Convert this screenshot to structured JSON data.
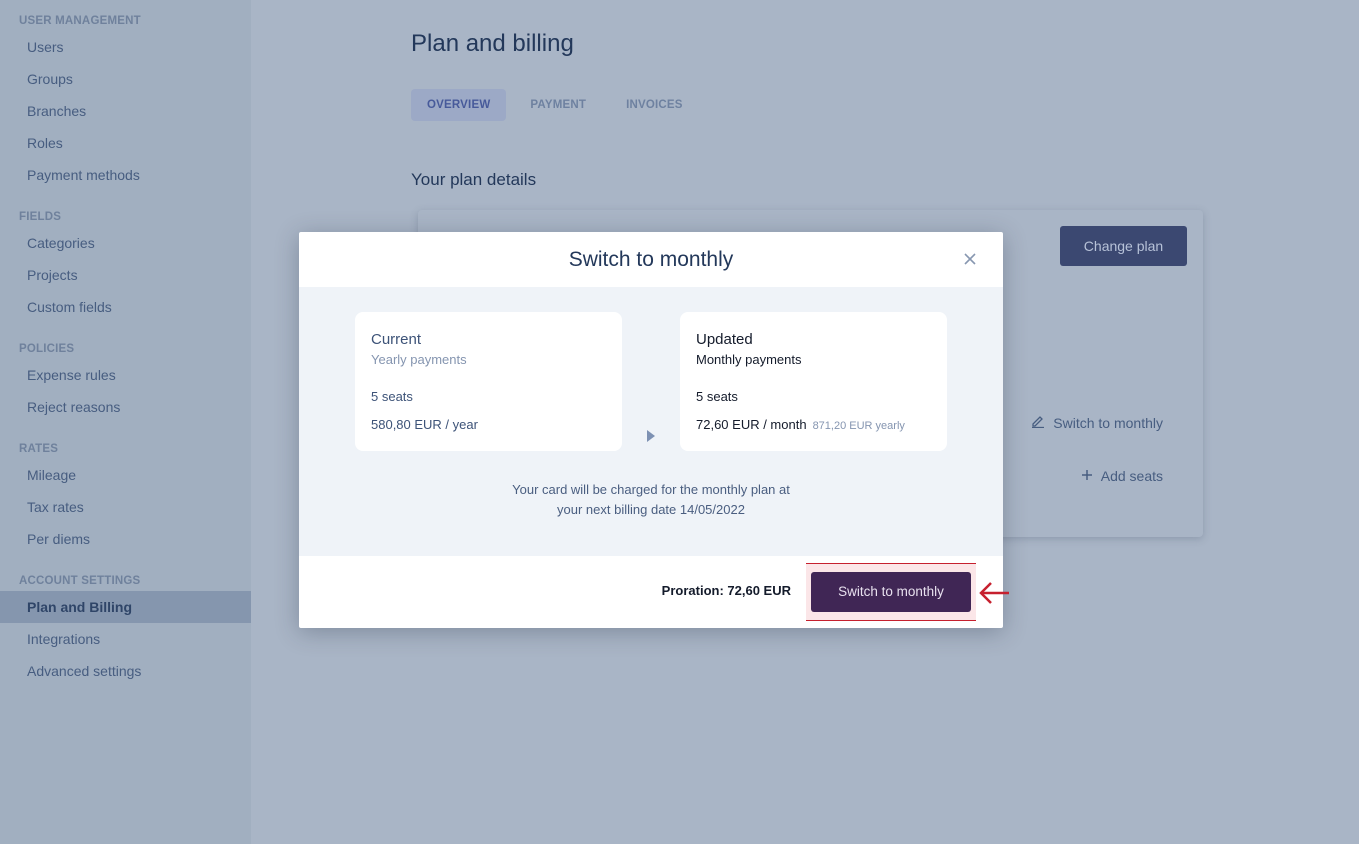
{
  "sidebar": {
    "sections": [
      {
        "heading": "USER MANAGEMENT",
        "items": [
          "Users",
          "Groups",
          "Branches",
          "Roles",
          "Payment methods"
        ]
      },
      {
        "heading": "FIELDS",
        "items": [
          "Categories",
          "Projects",
          "Custom fields"
        ]
      },
      {
        "heading": "POLICIES",
        "items": [
          "Expense rules",
          "Reject reasons"
        ]
      },
      {
        "heading": "RATES",
        "items": [
          "Mileage",
          "Tax rates",
          "Per diems"
        ]
      },
      {
        "heading": "ACCOUNT SETTINGS",
        "items": [
          "Plan and Billing",
          "Integrations",
          "Advanced settings"
        ]
      }
    ],
    "active_item": "Plan and Billing"
  },
  "main": {
    "title": "Plan and billing",
    "tabs": [
      {
        "label": "OVERVIEW",
        "active": true
      },
      {
        "label": "PAYMENT",
        "active": false
      },
      {
        "label": "INVOICES",
        "active": false
      }
    ],
    "section_title": "Your plan details",
    "change_plan_label": "Change plan",
    "switch_link_label": "Switch to monthly",
    "add_seats_label": "Add seats"
  },
  "modal": {
    "title": "Switch to monthly",
    "close_icon": "close-icon",
    "current": {
      "title": "Current",
      "subtitle": "Yearly payments",
      "seats": "5 seats",
      "price": "580,80 EUR / year"
    },
    "updated": {
      "title": "Updated",
      "subtitle": "Monthly payments",
      "seats": "5 seats",
      "price": "72,60 EUR / month",
      "yearly": "871,20 EUR yearly"
    },
    "charge_note_line1": "Your card will be charged for the monthly plan at",
    "charge_note_line2": "your next billing date 14/05/2022",
    "proration": "Proration: 72,60 EUR",
    "confirm_label": "Switch to monthly"
  },
  "colors": {
    "primary_button": "#402655",
    "highlight_red": "#c6202e",
    "change_plan_button": "#3b4871"
  }
}
